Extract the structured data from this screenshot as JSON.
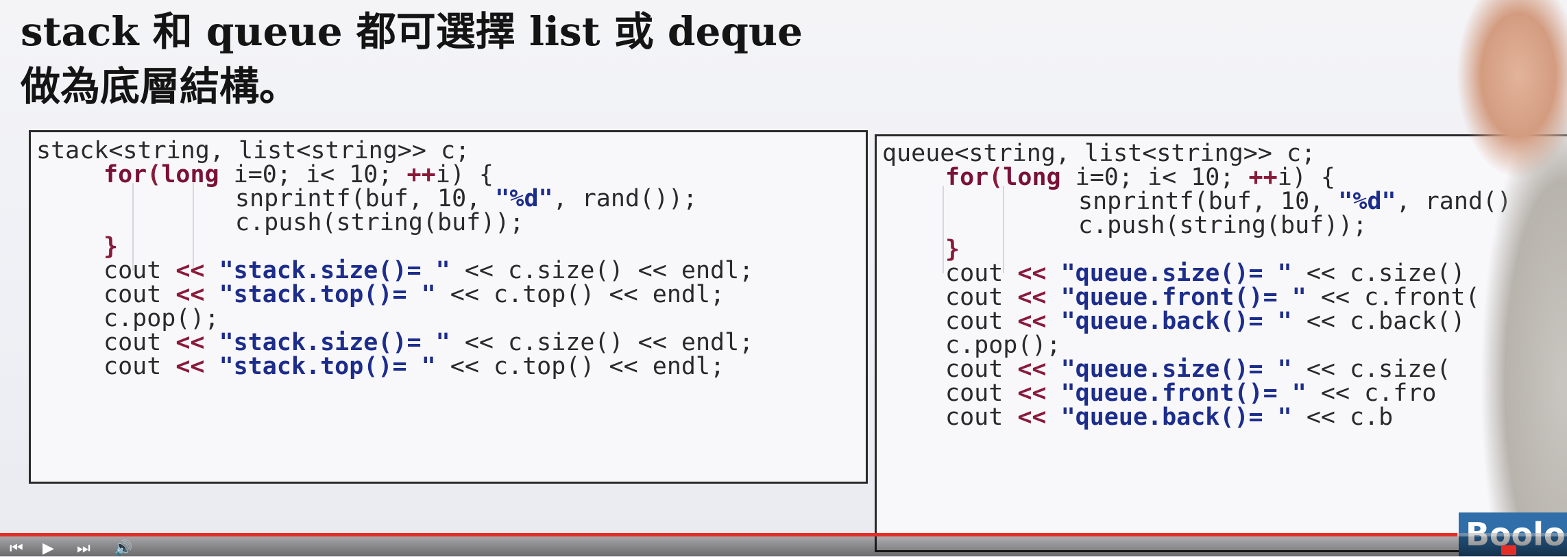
{
  "slide": {
    "title_line1": "stack 和 queue 都可選擇 list 或 deque",
    "title_line2": "做為底層結構。"
  },
  "code_left": {
    "l1": "stack<string, list<string>> c;",
    "l2a": "for",
    "l2b": "(",
    "l2c": "long",
    "l2d": " i=0; i< 10; ",
    "l2e": "++",
    "l2f": "i) {",
    "l3a": "snprintf(buf, 10, ",
    "l3b": "\"%d\"",
    "l3c": ", rand());",
    "l4": "c.push(string(buf));",
    "l5": "}",
    "l6a": "cout ",
    "l6b": "<<",
    "l6c": " \"stack.size()= \"",
    "l6d": " << c.size() << endl;",
    "l7a": "cout ",
    "l7b": "<<",
    "l7c": " \"stack.top()= \"",
    "l7d": " << c.top() << endl;",
    "l8": "c.pop();",
    "l9a": "cout ",
    "l9b": "<<",
    "l9c": " \"stack.size()= \"",
    "l9d": " << c.size() << endl;",
    "l10a": "cout ",
    "l10b": "<<",
    "l10c": " \"stack.top()= \"",
    "l10d": " << c.top() << endl;"
  },
  "code_right": {
    "l1": "queue<string, list<string>> c;",
    "l2a": "for",
    "l2b": "(",
    "l2c": "long",
    "l2d": " i=0; i< 10; ",
    "l2e": "++",
    "l2f": "i) {",
    "l3a": "snprintf(buf, 10, ",
    "l3b": "\"%d\"",
    "l3c": ", rand()",
    "l4": "c.push(string(buf));",
    "l5": "}",
    "l6a": "cout ",
    "l6b": "<<",
    "l6c": " \"queue.size()= \"",
    "l6d": " << c.size()",
    "l7a": "cout ",
    "l7b": "<<",
    "l7c": " \"queue.front()= \"",
    "l7d": " << c.front(",
    "l8a": "cout ",
    "l8b": "<<",
    "l8c": " \"queue.back()= \"",
    "l8d": " << c.back()",
    "l9": "c.pop();",
    "l10a": "cout ",
    "l10b": "<<",
    "l10c": " \"queue.size()= \"",
    "l10d": " << c.size(",
    "l11a": "cout ",
    "l11b": "<<",
    "l11c": " \"queue.front()= \"",
    "l11d": " << c.fro",
    "l12a": "cout ",
    "l12b": "<<",
    "l12c": " \"queue.back()= \"",
    "l12d": " << c.b"
  },
  "watermark": {
    "logo_text": "Boolo"
  },
  "player": {
    "progress": 0.93,
    "accent": "#e52d27"
  }
}
